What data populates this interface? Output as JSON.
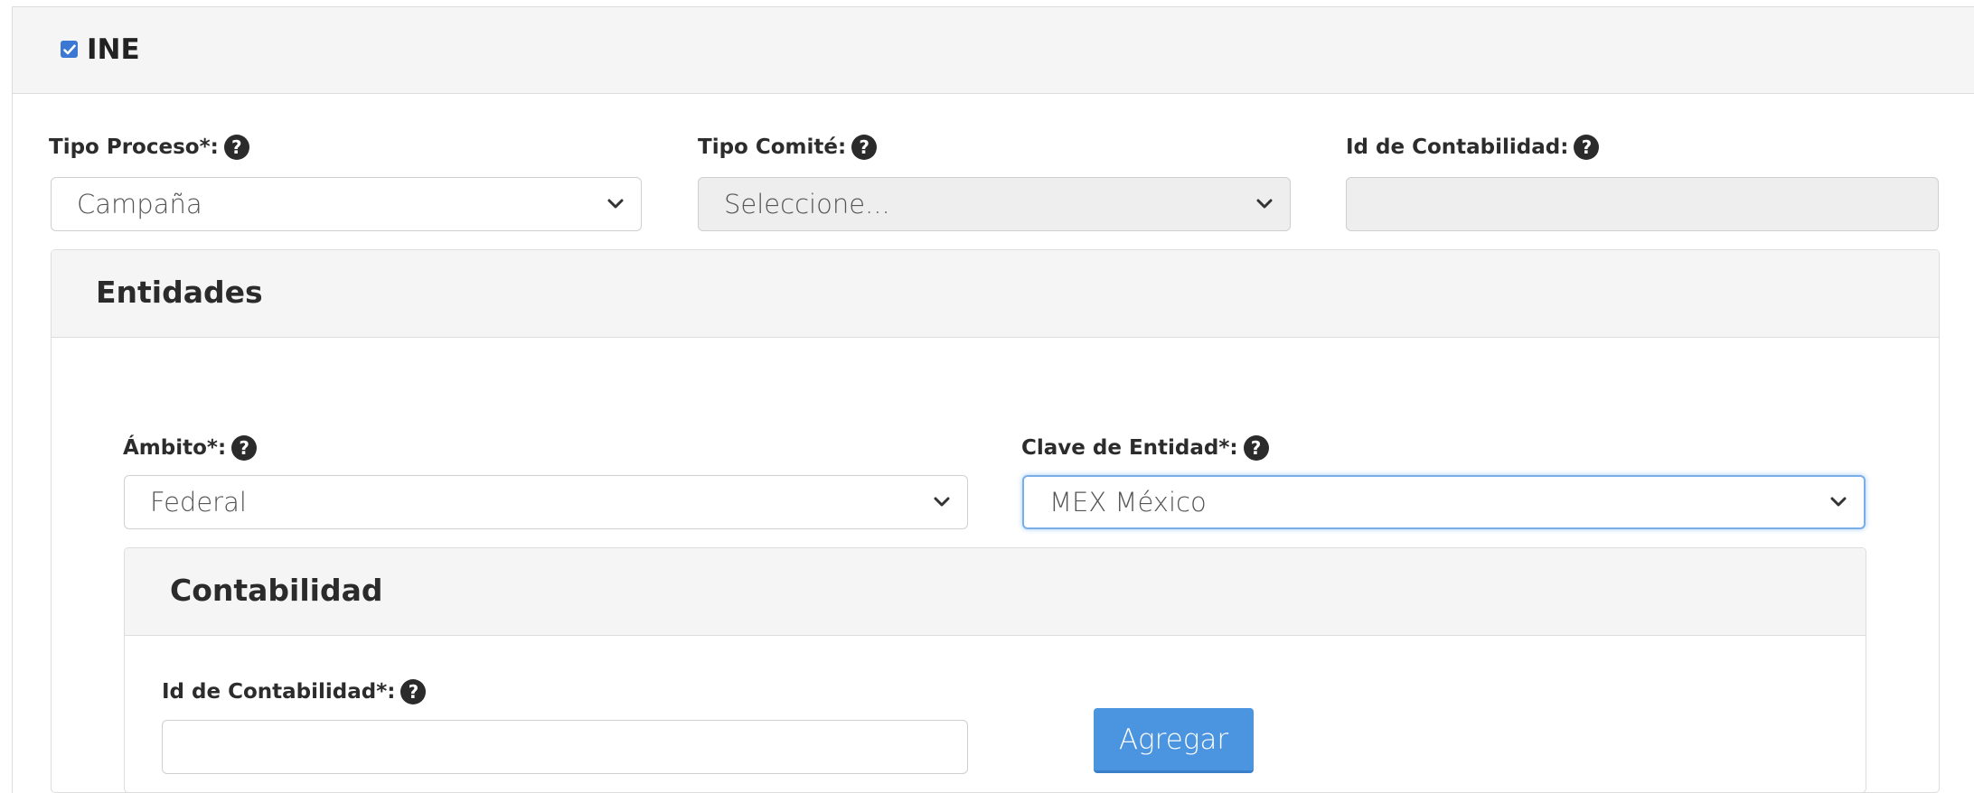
{
  "ine": {
    "label": "INE",
    "checked": true
  },
  "fields": {
    "tipo_proceso": {
      "label": "Tipo Proceso*:",
      "value": "Campaña"
    },
    "tipo_comite": {
      "label": "Tipo Comité:",
      "value": "Seleccione..."
    },
    "id_contabilidad_top": {
      "label": "Id de Contabilidad:",
      "value": ""
    }
  },
  "entidades": {
    "title": "Entidades",
    "ambito": {
      "label": "Ámbito*:",
      "value": "Federal"
    },
    "clave_entidad": {
      "label": "Clave de Entidad*:",
      "value": "MEX México"
    }
  },
  "contabilidad": {
    "title": "Contabilidad",
    "id_label": "Id de Contabilidad*:",
    "id_value": "",
    "add_button": "Agregar"
  },
  "colors": {
    "accent": "#4b94e0",
    "checkbox": "#3a78d3",
    "focus": "#7aaee8"
  }
}
